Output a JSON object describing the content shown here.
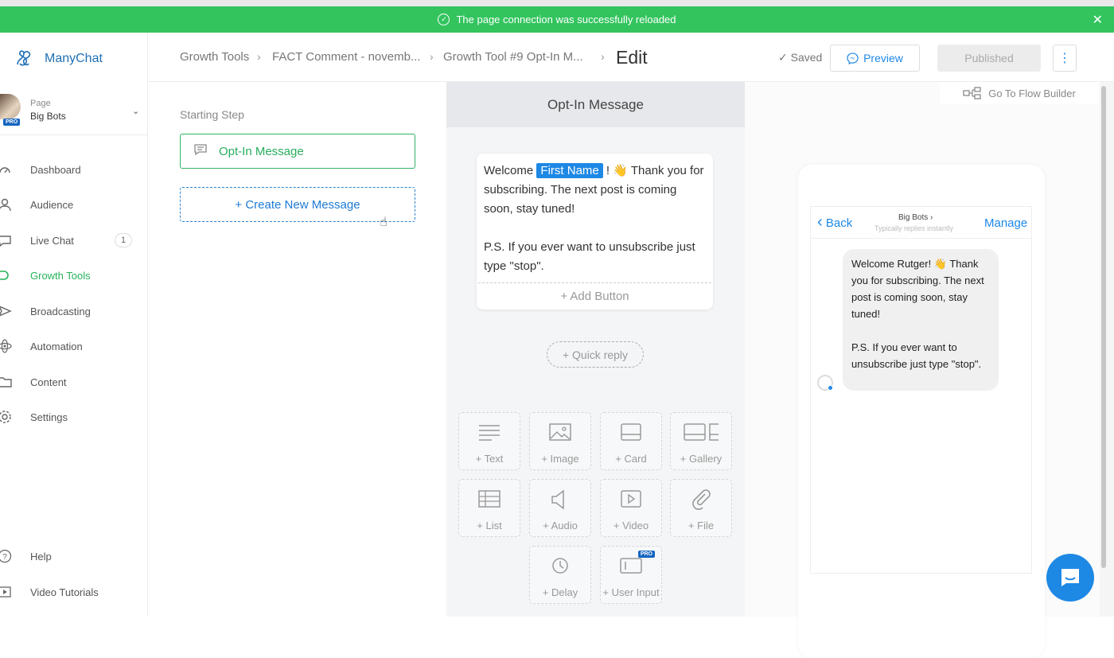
{
  "banner": {
    "message": "The page connection was successfully reloaded",
    "close": "✕"
  },
  "sidebar": {
    "brand": "ManyChat",
    "page_label": "Page",
    "page_name": "Big Bots",
    "pro": "PRO",
    "items": [
      {
        "label": "Dashboard"
      },
      {
        "label": "Audience"
      },
      {
        "label": "Live Chat",
        "badge": "1"
      },
      {
        "label": "Growth Tools"
      },
      {
        "label": "Broadcasting"
      },
      {
        "label": "Automation"
      },
      {
        "label": "Content"
      },
      {
        "label": "Settings"
      }
    ],
    "bottom": [
      {
        "label": "Help"
      },
      {
        "label": "Video Tutorials"
      }
    ]
  },
  "header": {
    "breadcrumb": [
      "Growth Tools",
      "FACT Comment - novemb...",
      "Growth Tool #9 Opt-In M..."
    ],
    "current": "Edit",
    "saved": "Saved",
    "preview": "Preview",
    "published": "Published"
  },
  "left": {
    "starting_step": "Starting Step",
    "optin": "Opt-In Message",
    "create": "+ Create New Message"
  },
  "editor": {
    "title": "Opt-In Message",
    "text_pre": "Welcome ",
    "first_name": "First Name",
    "text_post": " ! 👋 Thank you for subscribing. The next post is coming soon, stay tuned!",
    "text_ps": "P.S. If you ever want to unsubscribe just type \"stop\".",
    "add_button": "+ Add Button",
    "quick_reply": "+ Quick reply",
    "tiles": [
      "+ Text",
      "+ Image",
      "+ Card",
      "+ Gallery",
      "+ List",
      "+ Audio",
      "+ Video",
      "+ File",
      "+ Delay",
      "+ User Input"
    ],
    "tile_pro": "PRO"
  },
  "preview": {
    "flow_builder": "Go To Flow Builder",
    "back": "Back",
    "bot_name": "Big Bots",
    "bot_sub": "Typically replies instantly",
    "manage": "Manage",
    "msg_line1": "Welcome Rutger! 👋 Thank you for subscribing. The next post is coming soon, stay tuned!",
    "msg_line2": "P.S. If you ever want to unsubscribe just type \"stop\"."
  },
  "colors": {
    "accent_green": "#33c45e",
    "accent_blue": "#1e88e5"
  }
}
